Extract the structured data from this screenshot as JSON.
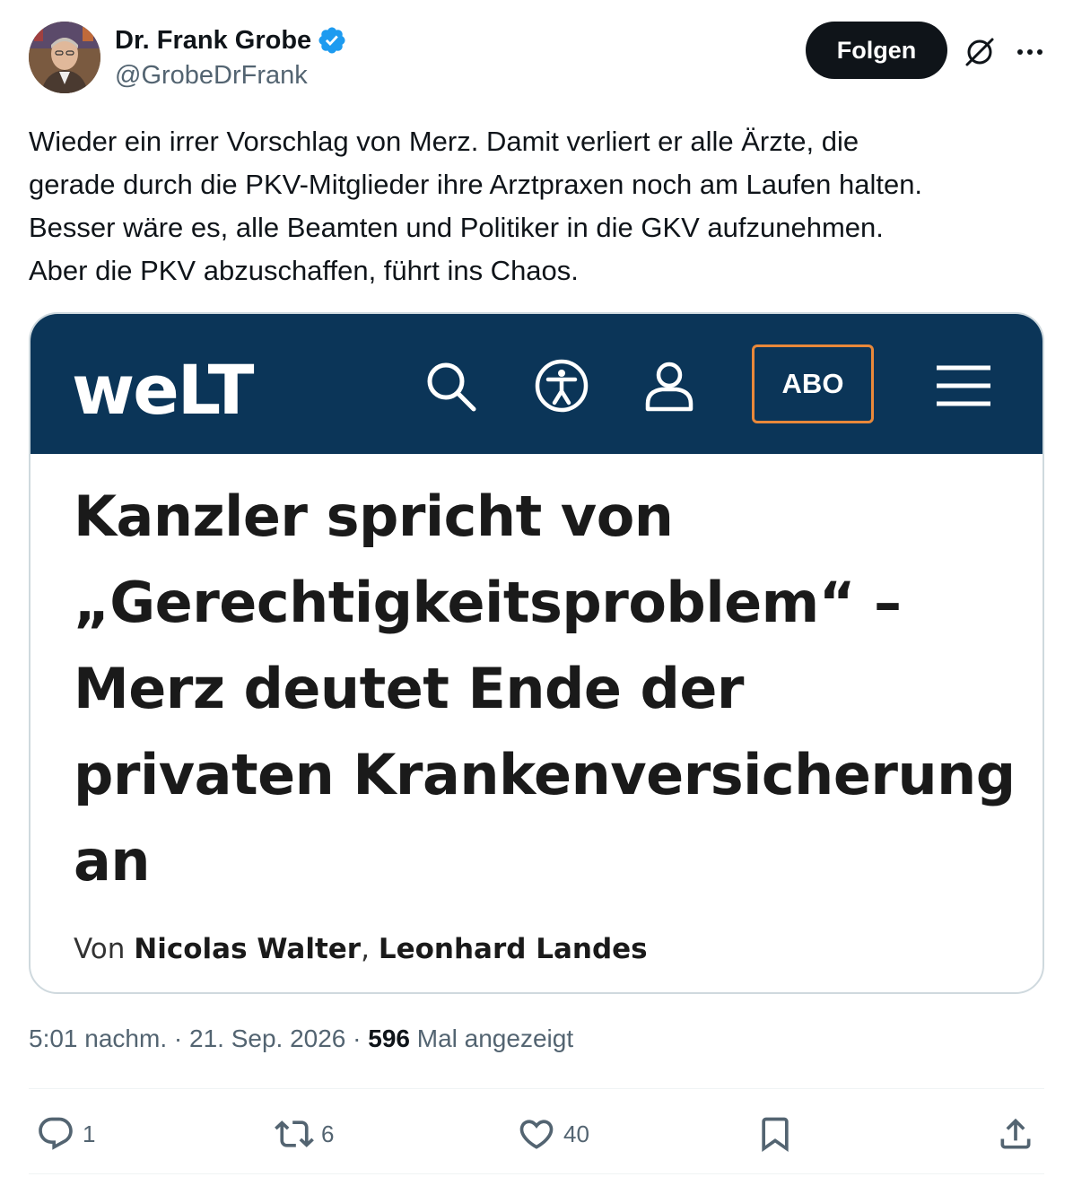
{
  "author": {
    "display_name": "Dr. Frank Grobe",
    "handle": "@GrobeDrFrank",
    "verified": true,
    "verified_color": "#1d9bf0"
  },
  "header": {
    "follow_label": "Folgen",
    "grok_icon": "grok-icon",
    "more_icon": "more-icon"
  },
  "tweet": {
    "text_lines": [
      "Wieder ein irrer Vorschlag von Merz. Damit verliert er alle Ärzte, die",
      "gerade durch die PKV-Mitglieder ihre Arztpraxen noch am Laufen halten.",
      "Besser wäre es, alle Beamten und Politiker in die GKV aufzunehmen.",
      "Aber die PKV abzuschaffen, führt ins Chaos."
    ]
  },
  "media": {
    "site_logo": "weLT",
    "bar_color": "#0b3558",
    "abo_label": "ABO",
    "abo_border_color": "#e9883a",
    "headline_lines": [
      "Kanzler spricht von",
      "„Gerechtigkeitsproblem“ –",
      "Merz deutet Ende der",
      "privaten Krankenversicherung",
      "an"
    ],
    "byline_prefix": "Von ",
    "byline_author1": "Nicolas Walter",
    "byline_sep": ", ",
    "byline_author2": "Leonhard Landes"
  },
  "meta": {
    "time": "5:01 nachm.",
    "sep1": " · ",
    "date": "21. Sep. 2026",
    "sep2": " · ",
    "views": "596",
    "views_label": " Mal angezeigt"
  },
  "actions": {
    "replies": "1",
    "reposts": "6",
    "likes": "40"
  }
}
